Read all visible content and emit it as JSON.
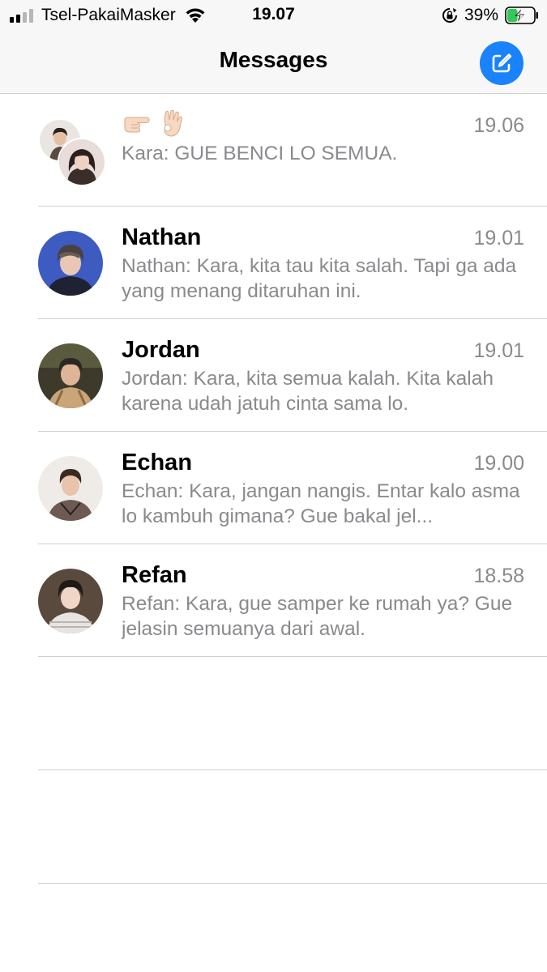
{
  "status_bar": {
    "carrier": "Tsel-PakaiMasker",
    "time": "19.07",
    "battery_percent": "39%",
    "battery_level": 0.39,
    "signal_bars": 2,
    "icons": [
      "signal-icon",
      "wifi-icon",
      "rotation-lock-icon",
      "battery-charging-icon"
    ]
  },
  "nav": {
    "title": "Messages",
    "compose_icon": "compose-icon",
    "accent": "#1a82fb"
  },
  "conversations": [
    {
      "name": "",
      "name_emojis": [
        "pointing-right-emoji",
        "ok-hand-emoji"
      ],
      "time": "19.06",
      "preview": "Kara: GUE BENCI LO SEMUA.",
      "group": true
    },
    {
      "name": "Nathan",
      "time": "19.01",
      "preview": "Nathan: Kara, kita tau kita salah. Tapi ga ada yang menang ditaruhan ini."
    },
    {
      "name": "Jordan",
      "time": "19.01",
      "preview": "Jordan: Kara, kita semua kalah. Kita kalah karena udah jatuh cinta sama lo."
    },
    {
      "name": "Echan",
      "time": "19.00",
      "preview": "Echan: Kara, jangan nangis. Entar kalo asma lo kambuh gimana? Gue bakal jel..."
    },
    {
      "name": "Refan",
      "time": "18.58",
      "preview": "Refan: Kara, gue samper ke rumah ya? Gue jelasin semuanya dari awal."
    }
  ],
  "colors": {
    "secondary_text": "#8a8a8e",
    "divider": "#cfcfcf",
    "bar_background": "#f7f7f7",
    "battery_green": "#34c759"
  }
}
